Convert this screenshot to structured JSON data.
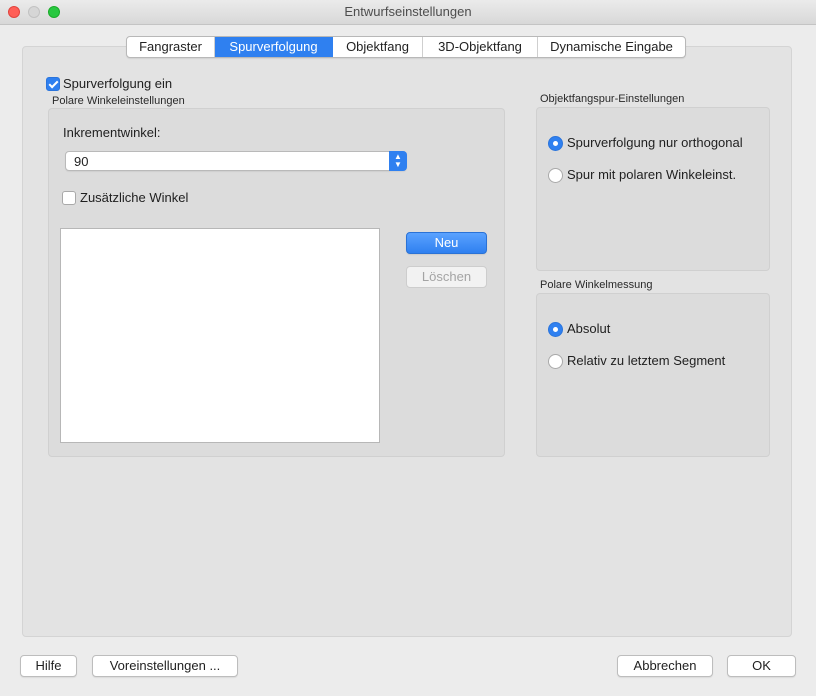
{
  "window": {
    "title": "Entwurfseinstellungen"
  },
  "tabs": [
    {
      "label": "Fangraster",
      "active": false
    },
    {
      "label": "Spurverfolgung",
      "active": true
    },
    {
      "label": "Objektfang",
      "active": false
    },
    {
      "label": "3D-Objektfang",
      "active": false
    },
    {
      "label": "Dynamische Eingabe",
      "active": false
    }
  ],
  "tracking": {
    "enable_label": "Spurverfolgung ein",
    "enabled": true
  },
  "polar": {
    "group_label": "Polare Winkeleinstellungen",
    "increment_label": "Inkrementwinkel:",
    "increment_value": "90",
    "additional_label": "Zusätzliche Winkel",
    "additional_checked": false,
    "new_button": "Neu",
    "delete_button": "Löschen"
  },
  "snap_tracking": {
    "group_label": "Objektfangspur-Einstellungen",
    "options": [
      "Spurverfolgung nur orthogonal",
      "Spur mit polaren Winkeleinst."
    ],
    "selected": 0
  },
  "polar_measure": {
    "group_label": "Polare Winkelmessung",
    "options": [
      "Absolut",
      "Relativ zu letztem Segment"
    ],
    "selected": 0
  },
  "footer": {
    "help": "Hilfe",
    "presets": "Voreinstellungen ...",
    "cancel": "Abbrechen",
    "ok": "OK"
  },
  "colors": {
    "accent": "#2f80f0",
    "panel": "#e3e3e3",
    "group": "#dcdcdc"
  }
}
